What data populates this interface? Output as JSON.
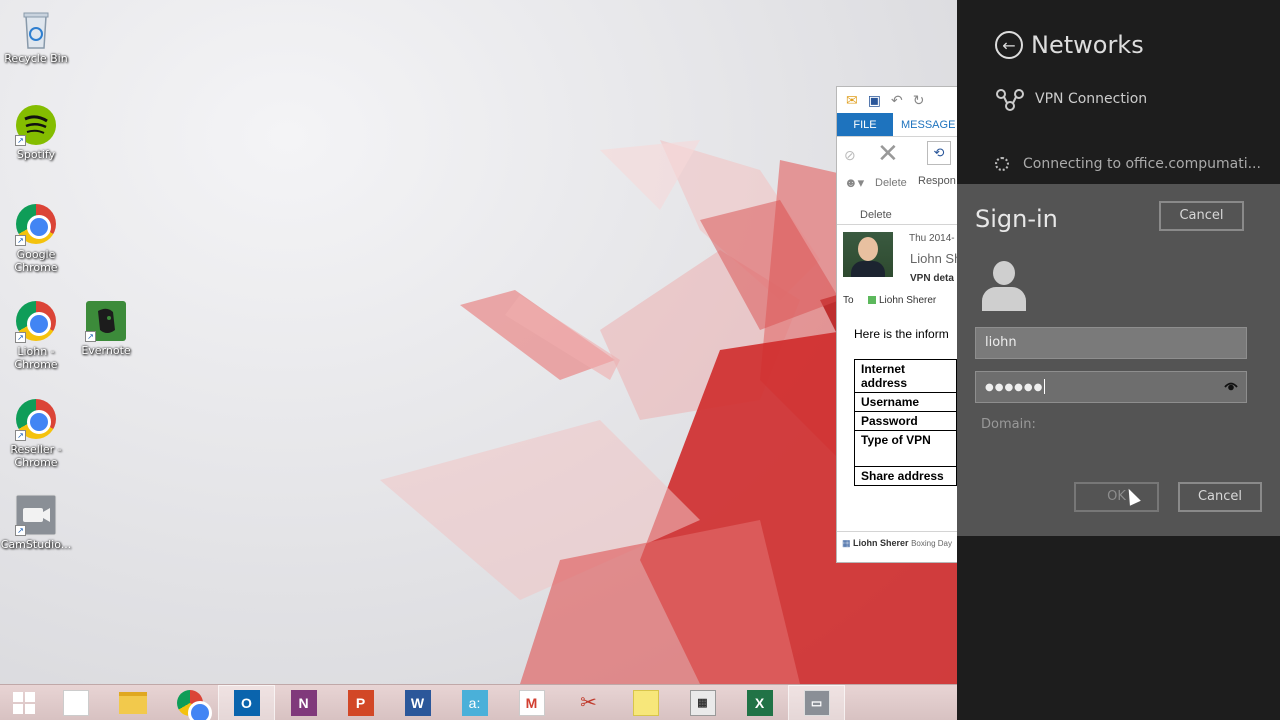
{
  "desktop": {
    "icons": [
      {
        "label": "Recycle Bin",
        "icon": "recycle-bin-icon"
      },
      {
        "label": "Spotify",
        "icon": "spotify-icon"
      },
      {
        "label": "Google Chrome",
        "icon": "chrome-icon"
      },
      {
        "label": "Liohn - Chrome",
        "icon": "chrome-icon"
      },
      {
        "label": "Evernote",
        "icon": "evernote-icon"
      },
      {
        "label": "Reseller - Chrome",
        "icon": "chrome-icon"
      },
      {
        "label": "CamStudio...",
        "icon": "camstudio-icon"
      }
    ]
  },
  "outlook": {
    "tab_file": "FILE",
    "tab_message": "MESSAGE",
    "delete_label": "Delete",
    "respond_label": "Respon",
    "group_delete": "Delete",
    "date": "Thu 2014-",
    "sender_short": "Liohn Sh",
    "subject_short": "VPN deta",
    "to_label": "To",
    "to_name": "Liohn Sherer",
    "body_intro": "Here is the inform",
    "table_rows": [
      "Internet address",
      "Username",
      "Password",
      "Type of VPN",
      "Share address"
    ],
    "status_name": "Liohn Sherer",
    "status_text": "Boxing Day"
  },
  "networks": {
    "title": "Networks",
    "vpn_name": "VPN Connection",
    "connecting": "Connecting to office.compumati..."
  },
  "signin": {
    "title": "Sign-in",
    "cancel_top": "Cancel",
    "username": "liohn",
    "password_mask": "●●●●●●",
    "domain_label": "Domain:",
    "ok_label": "OK",
    "cancel_label": "Cancel"
  },
  "taskbar": {
    "items": [
      "start",
      "apps",
      "file-explorer",
      "chrome",
      "outlook",
      "onenote",
      "powerpoint",
      "word",
      "app-store",
      "gmail",
      "snipping-tool",
      "sticky-notes",
      "calculator",
      "excel",
      "camstudio"
    ]
  },
  "colors": {
    "accent_blue": "#1e73be",
    "charm_bg": "#1d1d1d",
    "signin_bg": "#545454"
  }
}
